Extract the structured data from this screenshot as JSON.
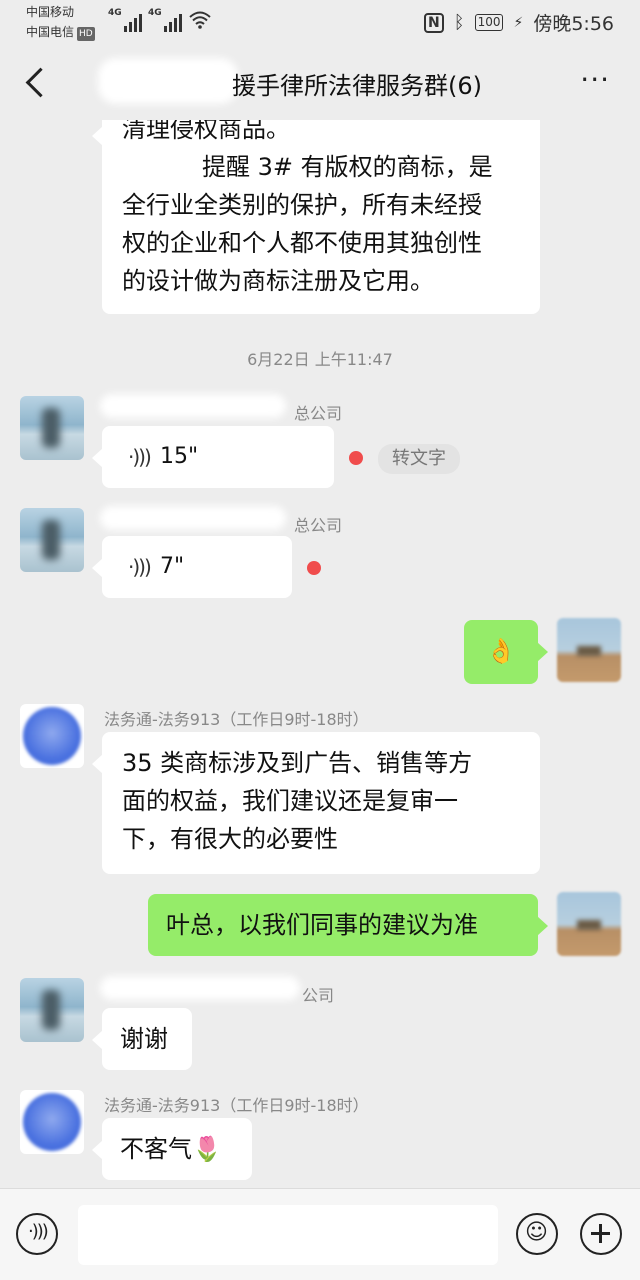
{
  "status_bar": {
    "carrier_1": "中国移动",
    "carrier_2": "中国电信",
    "hd": "HD",
    "net_1": "4G",
    "net_2": "4G",
    "battery": "100",
    "time": "傍晚5:56",
    "icons": [
      "signal-icon",
      "wifi-icon",
      "nfc-icon",
      "bluetooth-icon",
      "battery-icon",
      "charging-icon"
    ]
  },
  "header": {
    "title": "援手律所法律服务群(6)",
    "more": "···"
  },
  "messages": {
    "m1_lines": [
      "清理侵权商品。",
      "提醒 3# 有版权的商标，是",
      "全行业全类别的保护，所有未经授",
      "权的企业和个人都不使用其独创性",
      "的设计做为商标注册及它用。"
    ],
    "timestamp": "6月22日 上午11:47",
    "sender_company_suffix": "总公司",
    "voice_1": "15\"",
    "transcribe": "转文字",
    "voice_2": "7\"",
    "emoji_ok": "👌",
    "law_sender": "法务通-法务913（工作日9时-18时）",
    "m_law_lines": [
      "35 类商标涉及到广告、销售等方",
      "面的权益，我们建议还是复审一",
      "下，有很大的必要性"
    ],
    "m_self_2": "叶总，以我们同事的建议为准",
    "sender_company_suffix_2": "公司",
    "m_thanks": "谢谢",
    "m_welcome": "不客气🌷"
  },
  "input_bar": {
    "placeholder": ""
  },
  "colors": {
    "background": "#ededed",
    "self_bubble": "#95ec69",
    "other_bubble": "#ffffff",
    "unread_dot": "#f04c4c"
  }
}
